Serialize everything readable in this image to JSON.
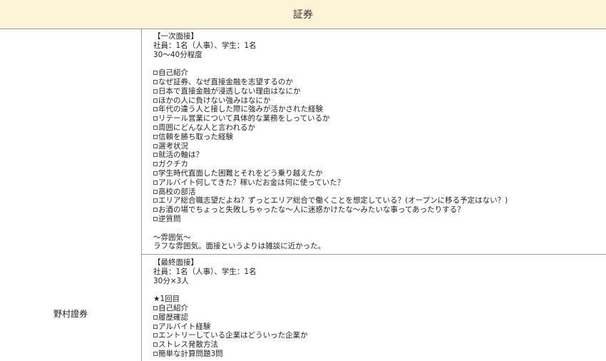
{
  "header": {
    "title": "証券"
  },
  "company": {
    "name": "野村證券"
  },
  "interview1": {
    "heading": "【一次面接】",
    "participants": "社員：1名（人事）、学生：1名",
    "duration": "30〜40分程度",
    "questions": [
      "自己紹介",
      "なぜ証券、なぜ直接金融を志望するのか",
      "日本で直接金融が浸透しない理由はなにか",
      "ほかの人に負けない強みはなにか",
      "年代の違う人と接した際に強みが活かされた経験",
      "リテール営業について具体的な業務をしっているか",
      "周囲にどんな人と言われるか",
      "信頼を勝ち取った経験",
      "選考状況",
      "就活の軸は？",
      "ガクチカ",
      "学生時代直面した困難とそれをどう乗り越えたか",
      "アルバイト何してきた？稼いだお金は何に使っていた？",
      "高校の部活",
      "エリア総合職志望だよね？ずっとエリア総合で働くことを想定している？(オープンに移る予定はない？)",
      "お酒の場でちょっと失敗しちゃったな〜人に迷惑かけたな〜みたいな事ってあったりする？",
      "逆質問"
    ],
    "atmosphere_heading": "〜雰囲気〜",
    "atmosphere": "ラフな雰囲気。面接というよりは雑談に近かった。"
  },
  "interview2": {
    "heading": "【最終面接】",
    "participants": "社員：1名（人事）、学生：1名",
    "duration": "30分×3人",
    "round": "★1回目",
    "questions": [
      "自己紹介",
      "履歴確認",
      "アルバイト経験",
      "エントリーしている企業はどういった企業か",
      "ストレス発散方法",
      "簡単な計算問題3問"
    ]
  }
}
